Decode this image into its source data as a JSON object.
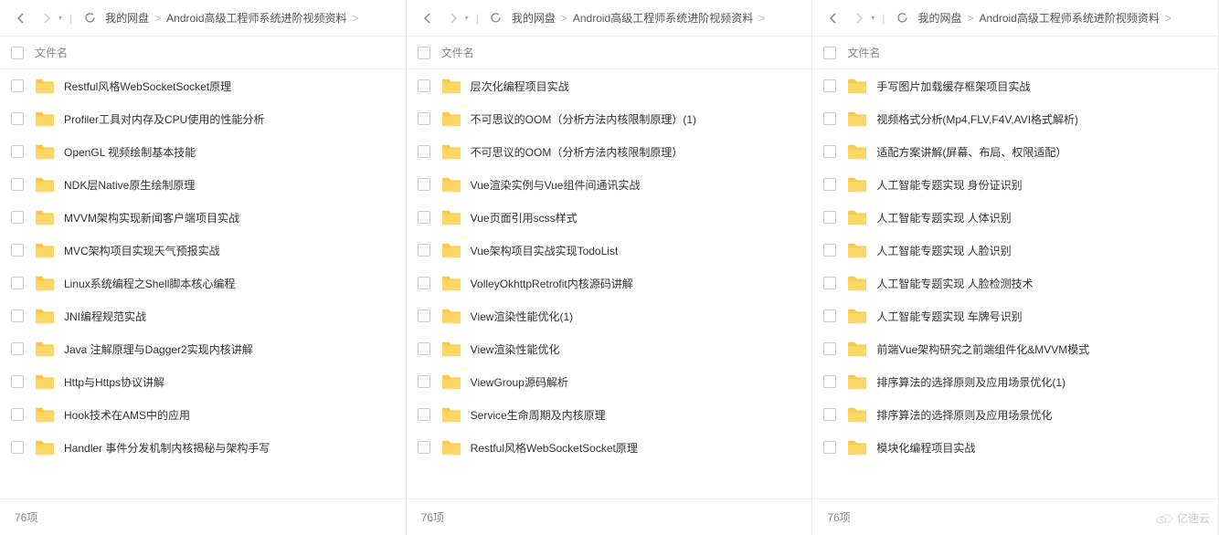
{
  "breadcrumb": {
    "root": "我的网盘",
    "folder": "Android高级工程师系统进阶视频资料"
  },
  "columns": {
    "name": "文件名"
  },
  "footer": {
    "count": "76项"
  },
  "watermark": "亿速云",
  "panels": [
    {
      "items": [
        {
          "name": "Restful风格WebSocketSocket原理"
        },
        {
          "name": "Profiler工具对内存及CPU使用的性能分析"
        },
        {
          "name": "OpenGL 视频绘制基本技能"
        },
        {
          "name": "NDK层Native原生绘制原理"
        },
        {
          "name": "MVVM架构实现新闻客户端项目实战"
        },
        {
          "name": "MVC架构项目实现天气预报实战"
        },
        {
          "name": "Linux系统编程之Shell脚本核心编程"
        },
        {
          "name": "JNI编程规范实战"
        },
        {
          "name": "Java 注解原理与Dagger2实现内核讲解"
        },
        {
          "name": "Http与Https协议讲解"
        },
        {
          "name": "Hook技术在AMS中的应用"
        },
        {
          "name": "Handler 事件分发机制内核揭秘与架构手写"
        }
      ]
    },
    {
      "items": [
        {
          "name": "层次化编程项目实战"
        },
        {
          "name": "不可思议的OOM（分析方法内核限制原理）(1)"
        },
        {
          "name": "不可思议的OOM（分析方法内核限制原理）"
        },
        {
          "name": "Vue渲染实例与Vue组件间通讯实战"
        },
        {
          "name": "Vue页面引用scss样式"
        },
        {
          "name": "Vue架构项目实战实现TodoList"
        },
        {
          "name": "VolleyOkhttpRetrofit内核源码讲解"
        },
        {
          "name": "View渲染性能优化(1)"
        },
        {
          "name": "View渲染性能优化"
        },
        {
          "name": "ViewGroup源码解析"
        },
        {
          "name": "Service生命周期及内核原理"
        },
        {
          "name": "Restful风格WebSocketSocket原理"
        }
      ]
    },
    {
      "items": [
        {
          "name": "手写图片加载缓存框架项目实战"
        },
        {
          "name": "视频格式分析(Mp4,FLV,F4V,AVI格式解析)"
        },
        {
          "name": "适配方案讲解(屏幕、布局、权限适配）"
        },
        {
          "name": "人工智能专题实现 身份证识别"
        },
        {
          "name": "人工智能专题实现 人体识别"
        },
        {
          "name": "人工智能专题实现 人脸识别"
        },
        {
          "name": "人工智能专题实现 人脸检测技术"
        },
        {
          "name": "人工智能专题实现 车牌号识别"
        },
        {
          "name": "前端Vue架构研究之前端组件化&MVVM模式"
        },
        {
          "name": "排序算法的选择原则及应用场景优化(1)"
        },
        {
          "name": "排序算法的选择原则及应用场景优化"
        },
        {
          "name": "模块化编程项目实战"
        }
      ]
    }
  ]
}
